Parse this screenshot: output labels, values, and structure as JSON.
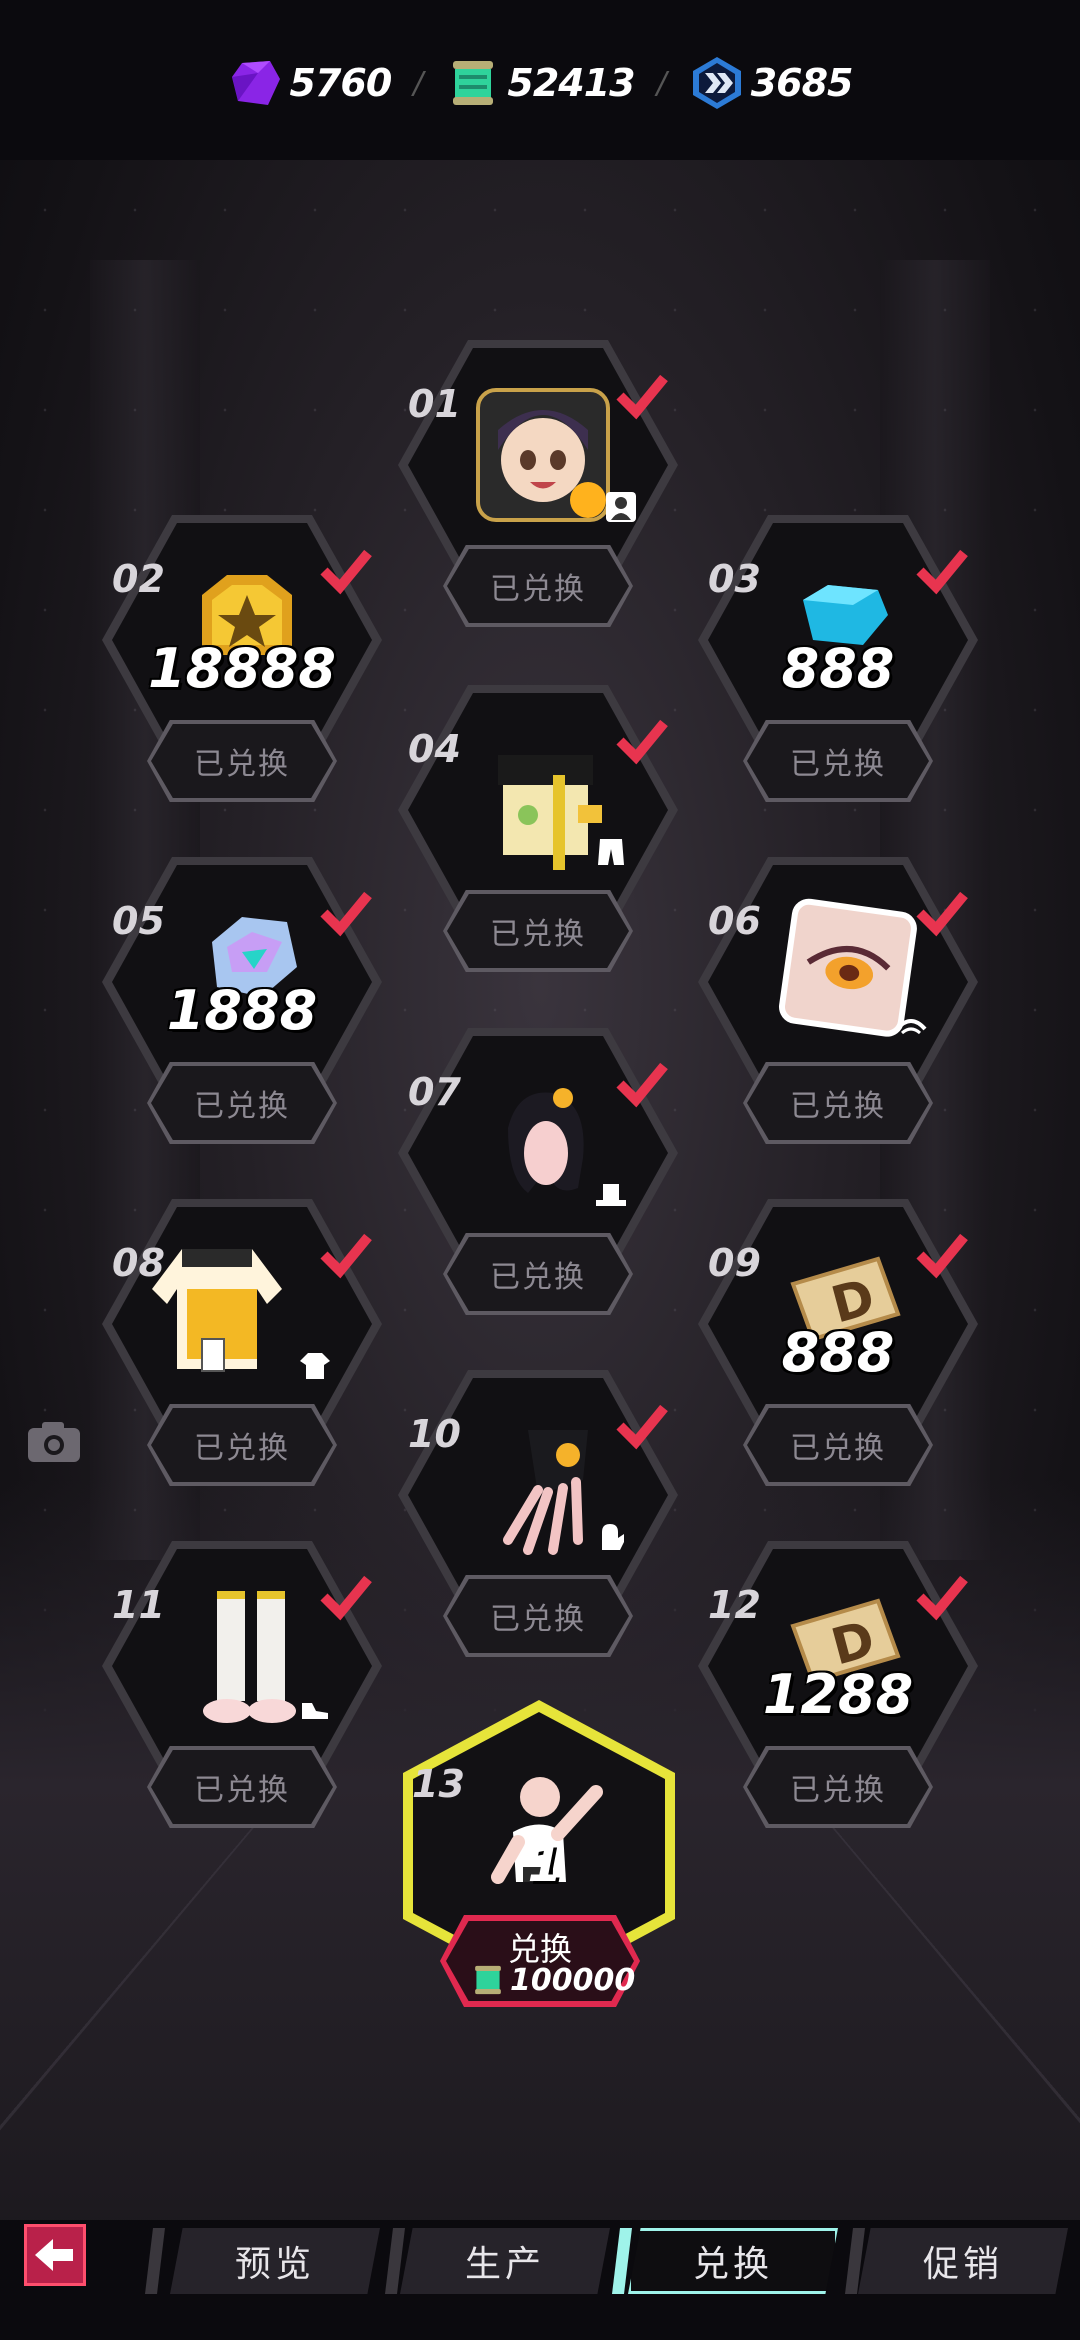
{
  "currency": [
    {
      "icon": "purple-gem-icon",
      "value": "5760"
    },
    {
      "icon": "green-scroll-icon",
      "value": "52413"
    },
    {
      "icon": "blue-chevron-icon",
      "value": "3685"
    }
  ],
  "separator": "/",
  "redeemed_label": "已兑换",
  "rewards": [
    {
      "num": "01",
      "item": "character-avatar-icon",
      "qty": "",
      "badge": "profile-icon"
    },
    {
      "num": "02",
      "item": "gold-badge-icon",
      "qty": "18888",
      "badge": ""
    },
    {
      "num": "03",
      "item": "blue-gem-icon",
      "qty": "888",
      "badge": ""
    },
    {
      "num": "04",
      "item": "skirt-outfit-icon",
      "qty": "",
      "badge": "pants-icon"
    },
    {
      "num": "05",
      "item": "crystal-shard-icon",
      "qty": "1888",
      "badge": ""
    },
    {
      "num": "06",
      "item": "eye-makeup-icon",
      "qty": "",
      "badge": "eye-icon"
    },
    {
      "num": "07",
      "item": "hairstyle-icon",
      "qty": "",
      "badge": "hat-icon"
    },
    {
      "num": "08",
      "item": "jacket-outfit-icon",
      "qty": "",
      "badge": "shirt-icon"
    },
    {
      "num": "09",
      "item": "d-ticket-icon",
      "qty": "888",
      "badge": ""
    },
    {
      "num": "10",
      "item": "glove-icon",
      "qty": "",
      "badge": "mitten-icon"
    },
    {
      "num": "11",
      "item": "socks-shoes-icon",
      "qty": "",
      "badge": "shoe-icon"
    },
    {
      "num": "12",
      "item": "d-ticket-icon",
      "qty": "1288",
      "badge": ""
    }
  ],
  "final_reward": {
    "num": "13",
    "item": "emote-pose-icon",
    "qty": "1",
    "button_label": "兑换",
    "cost": "100000",
    "cost_icon": "green-scroll-icon"
  },
  "nav": {
    "tabs": [
      "预览",
      "生产",
      "兑换",
      "促销"
    ],
    "active": "兑换"
  },
  "colors": {
    "check": "#e8344f",
    "accent_yellow": "#e6e43a",
    "active_tab": "#9ff3ea"
  }
}
